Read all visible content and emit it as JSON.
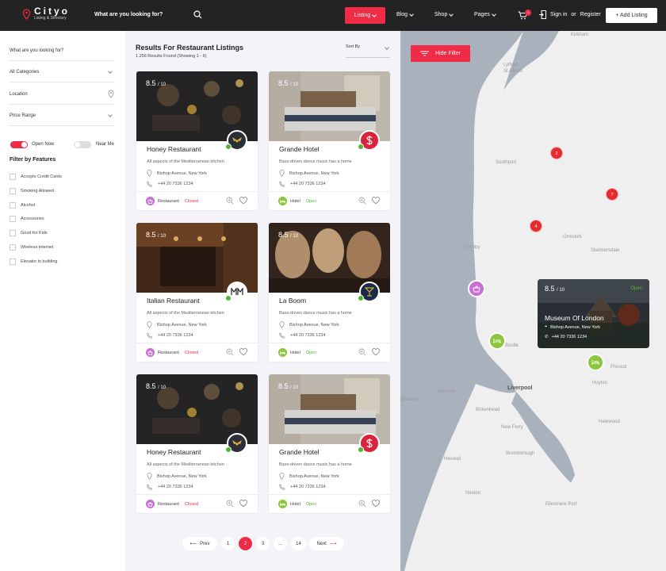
{
  "header": {
    "logo_title": "Cityo",
    "logo_subtitle": "Listing & Directory",
    "search_placeholder": "What are you looking for?",
    "nav": [
      "Listing",
      "Blog",
      "Shop",
      "Pages"
    ],
    "cart_count": "0",
    "sign_in": "Sign in",
    "or": "or",
    "register": "Register",
    "add_listing": "+ Add Listing"
  },
  "filter": {
    "search_label": "What are you looking for?",
    "categories": "All Categories",
    "location": "Location",
    "price_range": "Price Range",
    "open_now": "Open Now",
    "near_me": "Near Me",
    "features_title": "Filter by Features",
    "features": [
      "Accepts Credit Cards",
      "Smoking Allowed",
      "Alcohol",
      "Accessories",
      "Good for Kids",
      "Wireless Internet",
      "Elevator in building"
    ]
  },
  "results": {
    "title": "Results For Restaurant Listings",
    "count": "1.256 Results Found (Showing 1 - 6)",
    "sort": "Sort By"
  },
  "cards": [
    {
      "rating": "8.5",
      "scale": "/ 10",
      "name": "Honey Restaurant",
      "desc": "All aspects of the Mediterranean kitchen",
      "address": "Bishop Avenue, New York",
      "phone": "+44 20 7336 1234",
      "category": "Restaurant",
      "status": "Closed"
    },
    {
      "rating": "8.5",
      "scale": "/ 10",
      "name": "Grande Hotel",
      "desc": "Bass-driven dance music has a home",
      "address": "Bishop Avenue, New York",
      "phone": "+44 20 7336 1234",
      "category": "Hotel",
      "status": "Open"
    },
    {
      "rating": "8.5",
      "scale": "/ 10",
      "name": "Italian Restaurant",
      "desc": "All aspects of the Mediterranean kitchen",
      "address": "Bishop Avenue, New York",
      "phone": "+44 20 7336 1234",
      "category": "Restaurant",
      "status": "Closed"
    },
    {
      "rating": "8.5",
      "scale": "/ 10",
      "name": "La Boom",
      "desc": "Bass-driven dance music has a home",
      "address": "Bishop Avenue, New York",
      "phone": "+44 20 7336 1234",
      "category": "Hotel",
      "status": "Open"
    },
    {
      "rating": "8.5",
      "scale": "/ 10",
      "name": "Honey Restaurant",
      "desc": "All aspects of the Mediterranean kitchen",
      "address": "Bishop Avenue, New York",
      "phone": "+44 20 7336 1234",
      "category": "Restaurant",
      "status": "Closed"
    },
    {
      "rating": "8.5",
      "scale": "/ 10",
      "name": "Grande Hotel",
      "desc": "Bass-driven dance music has a home",
      "address": "Bishop Avenue, New York",
      "phone": "+44 20 7336 1234",
      "category": "Hotel",
      "status": "Open"
    }
  ],
  "pagination": {
    "prev": "Prev",
    "pages": [
      "1",
      "2",
      "3",
      "...",
      "14"
    ],
    "current": "2",
    "next": "Next"
  },
  "map": {
    "hide_filter": "Hide Filter",
    "places": [
      "Kirkham",
      "Lytham",
      "St Annes",
      "Southport",
      "Formby",
      "Ormskirk",
      "Skelmersdale",
      "Bootle",
      "Liverpool",
      "Prescot",
      "Huyton",
      "Moreton",
      "Wallasey",
      "Birkenhead",
      "New Ferry",
      "Heswall",
      "Neston",
      "Bromborough",
      "Halewood",
      "Ellesmere Port"
    ],
    "clusters": [
      "2",
      "7",
      "4"
    ],
    "popup": {
      "rating": "8.5",
      "scale": "/ 10",
      "status": "Open",
      "name": "Museum Of London",
      "address": "Bishop Avenue, New York",
      "phone": "+44 20 7336 1234"
    }
  },
  "colors": {
    "accent": "#ef2b45",
    "open": "#54b435",
    "closed": "#ef2b45",
    "header_bg": "#232323",
    "restaurant_icon": "#c86fd6",
    "hotel_icon": "#8cc63f"
  }
}
